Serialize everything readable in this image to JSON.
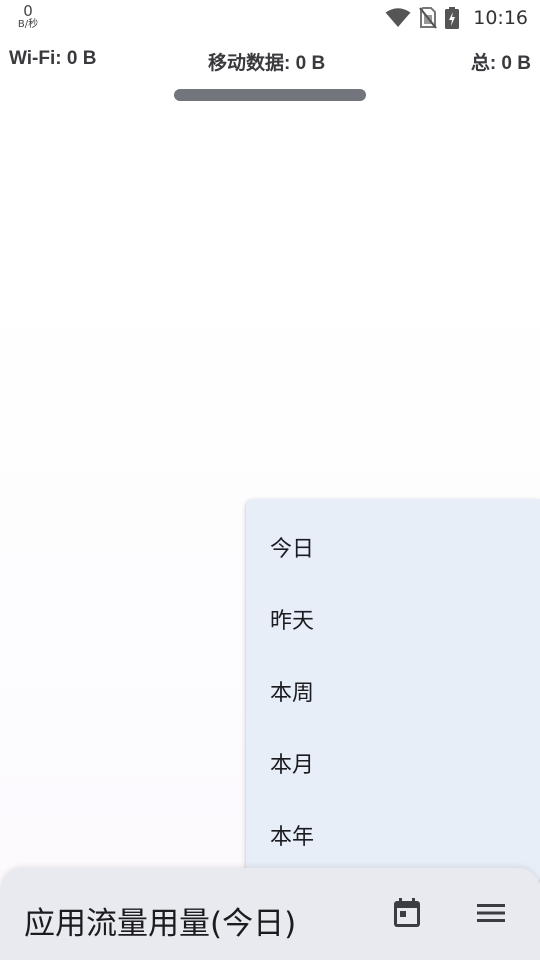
{
  "status_bar": {
    "net_speed_value": "0",
    "net_speed_unit": "B/秒",
    "time": "10:16",
    "icons": [
      "wifi-icon",
      "no-sim-icon",
      "battery-charging-icon"
    ]
  },
  "summary": {
    "wifi": "Wi-Fi: 0 B",
    "mobile": "移动数据: 0 B",
    "total": "总: 0 B"
  },
  "menu": {
    "items": [
      {
        "label": "今日"
      },
      {
        "label": "昨天"
      },
      {
        "label": "本周"
      },
      {
        "label": "本月"
      },
      {
        "label": "本年"
      }
    ]
  },
  "bottom_bar": {
    "title": "应用流量用量(今日)",
    "icons": [
      "calendar-icon",
      "menu-icon"
    ]
  },
  "colors": {
    "menu_background": "#e8eef8",
    "bottom_bar_background": "#e8eaf0",
    "progress_bar": "#72757c"
  }
}
